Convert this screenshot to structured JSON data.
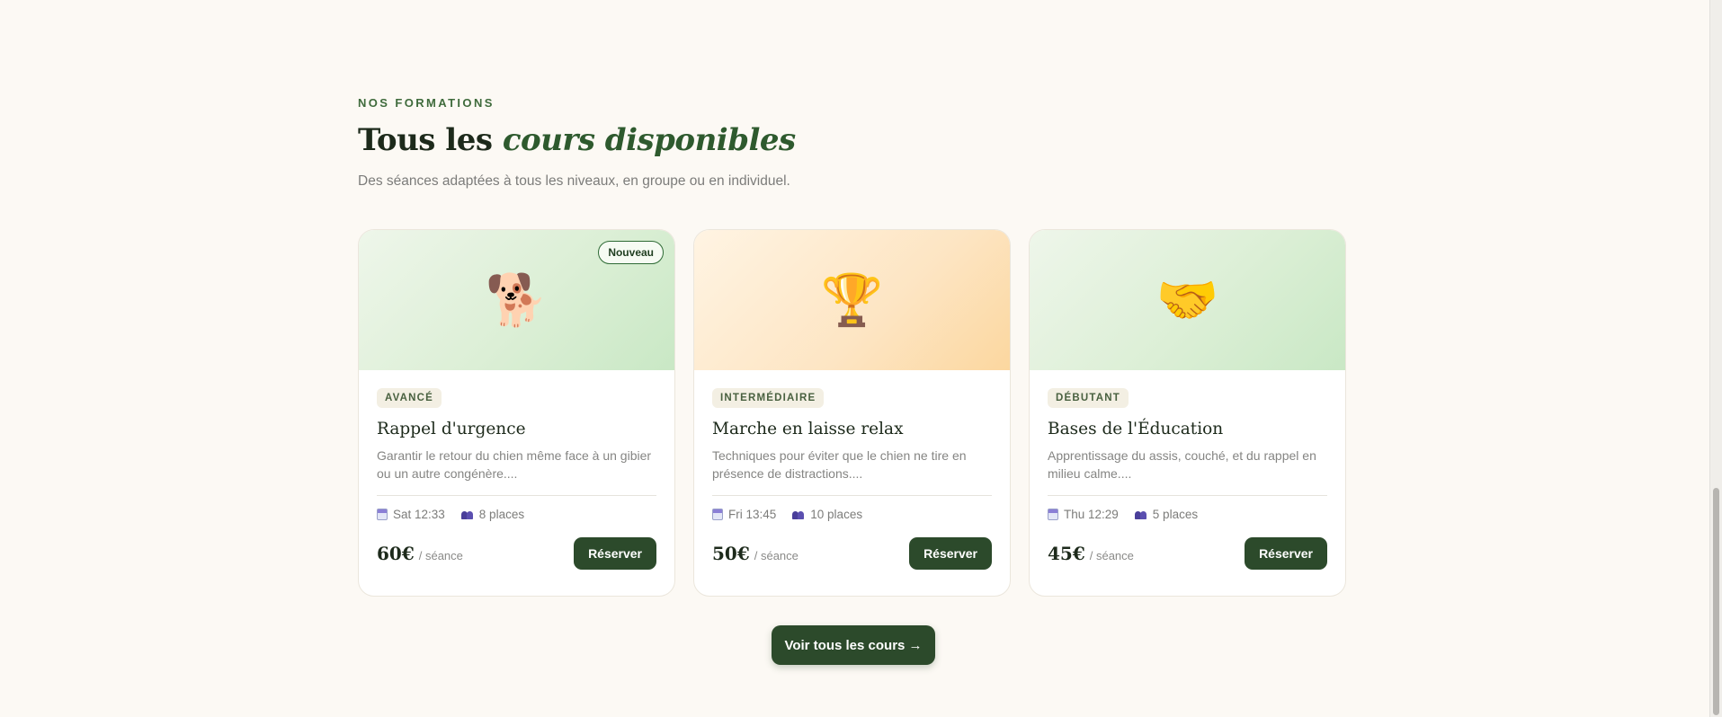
{
  "section": {
    "eyebrow": "NOS FORMATIONS",
    "title_plain": "Tous les",
    "title_emphasis": "cours disponibles",
    "subtitle": "Des séances adaptées à tous les niveaux, en groupe ou en individuel."
  },
  "courses": [
    {
      "emoji": "🐕",
      "icon_name": "dog-icon",
      "badge": "Nouveau",
      "level": "AVANCÉ",
      "title": "Rappel d'urgence",
      "description": "Garantir le retour du chien même face à un gibier ou un autre congénère....",
      "schedule": "Sat 12:33",
      "places": "8 places",
      "price": "60€",
      "price_unit": "/ séance",
      "cta": "Réserver"
    },
    {
      "emoji": "🏆",
      "icon_name": "trophy-icon",
      "level": "INTERMÉDIAIRE",
      "title": "Marche en laisse relax",
      "description": "Techniques pour éviter que le chien ne tire en présence de distractions....",
      "schedule": "Fri 13:45",
      "places": "10 places",
      "price": "50€",
      "price_unit": "/ séance",
      "cta": "Réserver"
    },
    {
      "emoji": "🤝",
      "icon_name": "handshake-icon",
      "level": "DÉBUTANT",
      "title": "Bases de l'Éducation",
      "description": "Apprentissage du assis, couché, et du rappel en milieu calme....",
      "schedule": "Thu 12:29",
      "places": "5 places",
      "price": "45€",
      "price_unit": "/ séance",
      "cta": "Réserver"
    }
  ],
  "all_courses_button": "Voir tous les cours →",
  "colors": {
    "background": "#fcf9f4",
    "accent_dark_green": "#2c4a2b",
    "heading_emphasis": "#2e5a2e"
  }
}
